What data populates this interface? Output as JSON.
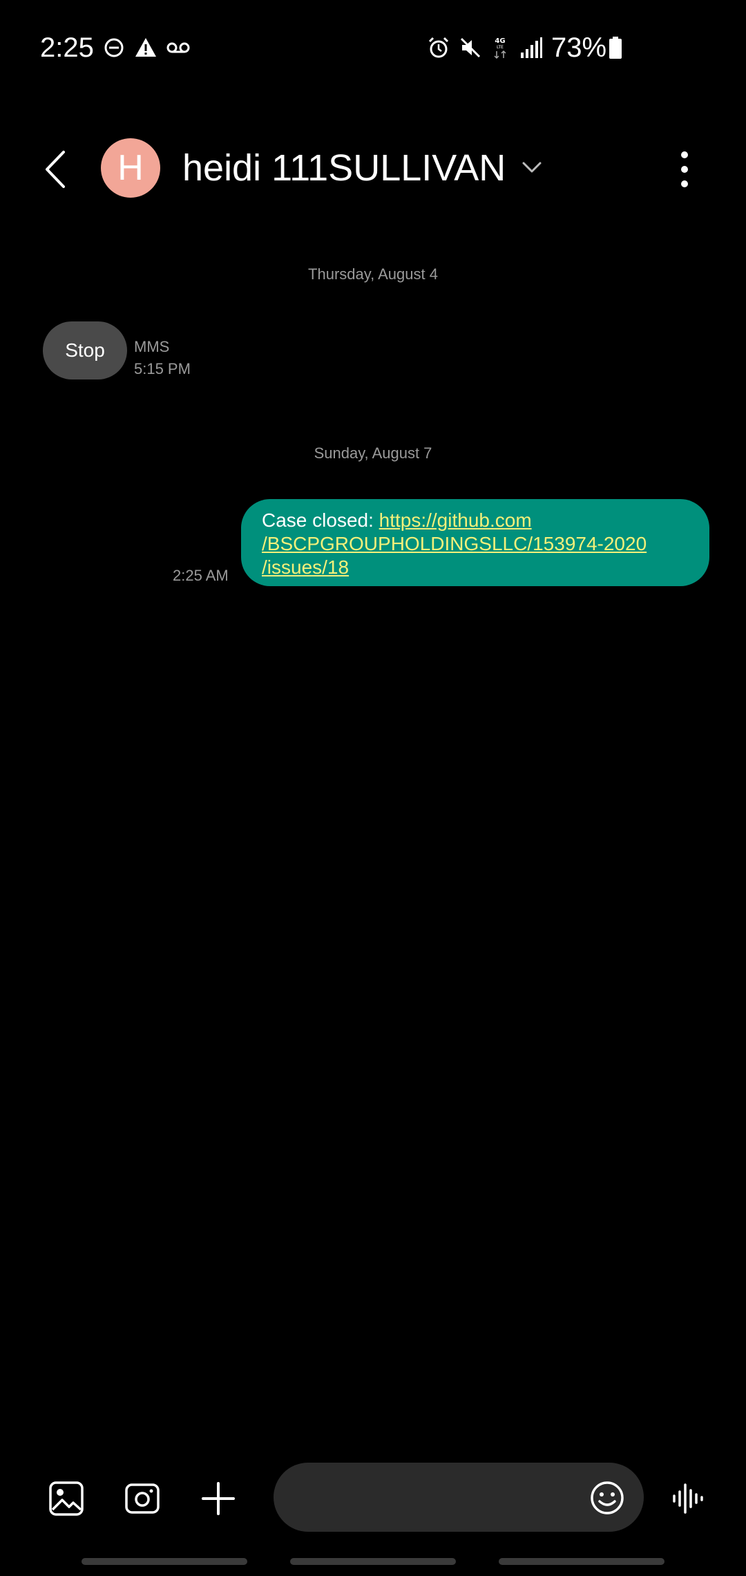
{
  "status_bar": {
    "time": "2:25",
    "battery": "73%",
    "icons": [
      "do-not-disturb-icon",
      "warning-icon",
      "voicemail-icon",
      "alarm-icon",
      "mute-icon",
      "4g-lte-icon",
      "signal-icon",
      "battery-icon"
    ]
  },
  "header": {
    "avatar_letter": "H",
    "contact_name": "heidi 111SULLIVAN"
  },
  "conversation": {
    "date_1": "Thursday, August 4",
    "received_message": "Stop",
    "received_type": "MMS",
    "received_time": "5:15 PM",
    "date_2": "Sunday, August 7",
    "sent_prefix": "Case closed: ",
    "sent_link_line1": "https://github.com",
    "sent_link_line2": "/BSCPGROUPHOLDINGSLLC/153974-2020",
    "sent_link_line3": "/issues/18",
    "sent_time": "2:25 AM"
  },
  "composer": {
    "input_placeholder": ""
  },
  "colors": {
    "background": "#000000",
    "avatar": "#f2a697",
    "sent_bubble": "#00907c",
    "received_bubble": "#4a4a4a",
    "link": "#f4f07a"
  }
}
